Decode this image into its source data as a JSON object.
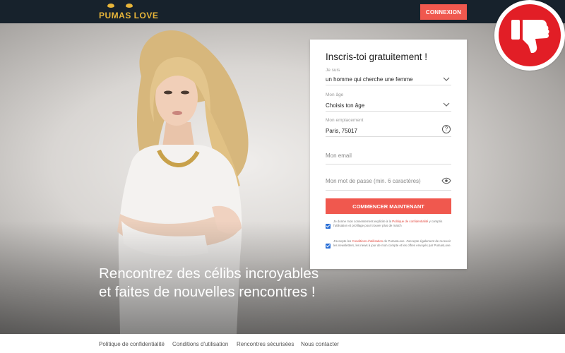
{
  "header": {
    "logo_text": "PUMAS LOVE",
    "login_label": "CONNEXION"
  },
  "hero": {
    "heading": "Rencontrez des célibs incroyables et faites de nouvelles rencontres !"
  },
  "form": {
    "title": "Inscris-toi gratuitement !",
    "fields": [
      {
        "label": "Je suis",
        "value": "un homme qui cherche une femme",
        "icon": "chevron-down-icon"
      },
      {
        "label": "Mon âge",
        "value": "Choisis ton âge",
        "icon": "chevron-down-icon"
      },
      {
        "label": "Mon emplacement",
        "value": "Paris, 75017",
        "icon": "help-icon"
      },
      {
        "placeholder": "Mon email"
      },
      {
        "placeholder": "Mon mot de passe (min. 6 caractères)",
        "icon": "eye-icon"
      }
    ],
    "help_glyph": "?",
    "submit_label": "COMMENCER MAINTENANT",
    "consent_1": {
      "before": "Je donne mon consentement explicite à la",
      "link": "Politique de confidentialité",
      "after": "y compris l'utilisation et profilage pour trouver plus de match"
    },
    "consent_2": {
      "before": "J'accepte les",
      "link": "Conditions d'utilisation",
      "after": "de PumasLove. J'accepte également de recevoir les newsletters, les news à jour de mon compte et les offres envoyés par PumasLove."
    }
  },
  "footer": {
    "links": [
      "Politique de confidentialité",
      "Conditions d'utilisation",
      "Rencontres sécurisées",
      "Nous contacter"
    ]
  },
  "colors": {
    "header_bg": "#17222c",
    "accent": "#f0584e",
    "logo": "#e7b53a",
    "badge": "#e21e26"
  }
}
